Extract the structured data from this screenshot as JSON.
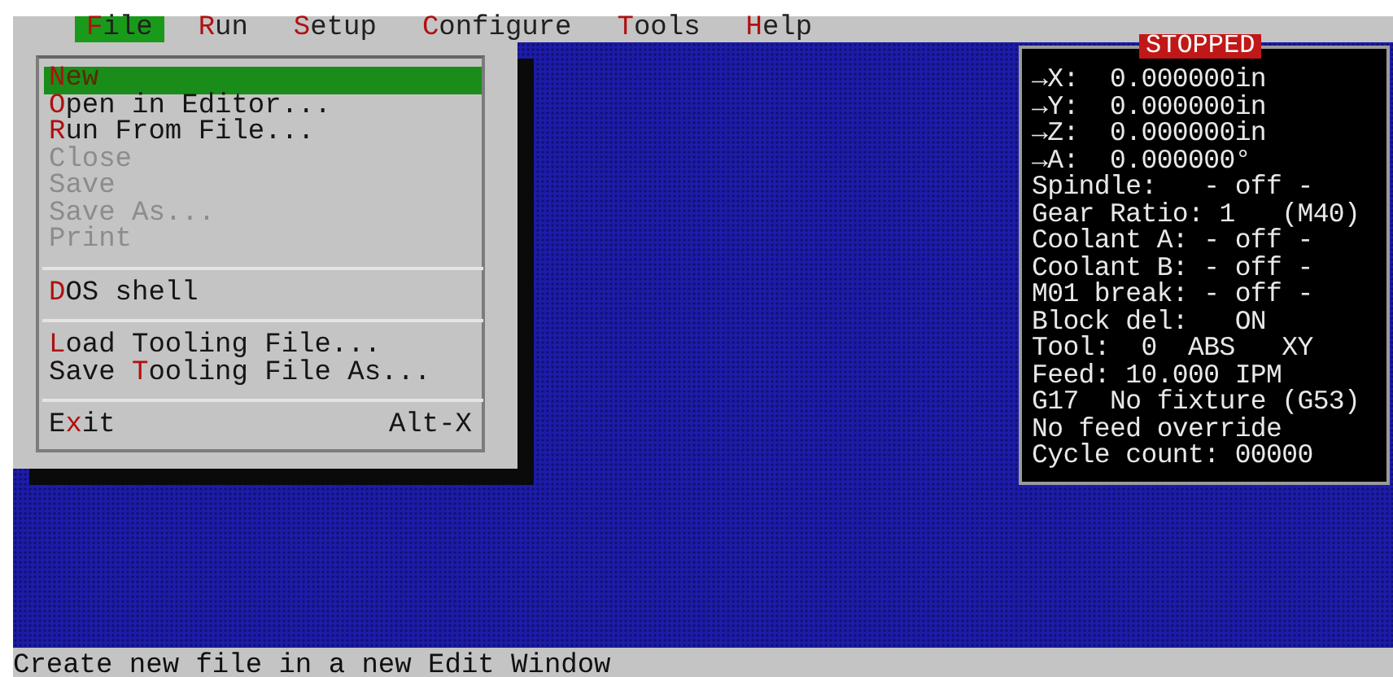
{
  "menu_bar": [
    {
      "key": "F",
      "rest": "ile",
      "selected": true
    },
    {
      "key": "R",
      "rest": "un",
      "selected": false
    },
    {
      "key": "S",
      "rest": "etup",
      "selected": false
    },
    {
      "key": "C",
      "rest": "onfigure",
      "selected": false
    },
    {
      "key": "T",
      "rest": "ools",
      "selected": false
    },
    {
      "key": "H",
      "rest": "elp",
      "selected": false
    }
  ],
  "file_menu": {
    "groups": [
      [
        {
          "key": "N",
          "rest": "ew",
          "selected": true,
          "disabled": false
        },
        {
          "key": "O",
          "rest": "pen in Editor...",
          "selected": false,
          "disabled": false
        },
        {
          "key": "R",
          "rest": "un From File...",
          "selected": false,
          "disabled": false
        },
        {
          "rest": "Close",
          "selected": false,
          "disabled": true
        },
        {
          "rest": "Save",
          "selected": false,
          "disabled": true
        },
        {
          "rest": "Save As...",
          "selected": false,
          "disabled": true
        },
        {
          "rest": "Print",
          "selected": false,
          "disabled": true
        }
      ],
      [
        {
          "key": "D",
          "rest": "OS shell",
          "selected": false,
          "disabled": false
        }
      ],
      [
        {
          "key": "L",
          "rest": "oad Tooling File...",
          "selected": false,
          "disabled": false
        },
        {
          "before": "Save ",
          "key": "T",
          "rest": "ooling File As...",
          "selected": false,
          "disabled": false
        }
      ],
      [
        {
          "before": "E",
          "key": "x",
          "rest": "it",
          "shortcut": "Alt-X",
          "selected": false,
          "disabled": false
        }
      ]
    ]
  },
  "status_panel": {
    "title": "STOPPED",
    "lines": [
      "→X:  0.000000in",
      "→Y:  0.000000in",
      "→Z:  0.000000in",
      "→A:  0.000000°",
      "Spindle:   - off -",
      "Gear Ratio: 1   (M40)",
      "Coolant A: - off -",
      "Coolant B: - off -",
      "M01 break: - off -",
      "Block del:   ON",
      "Tool:  0  ABS   XY",
      "Feed: 10.000 IPM",
      "G17  No fixture (G53)",
      "No feed override",
      "Cycle count: 00000"
    ]
  },
  "status_bar": "Create new file in a new Edit Window"
}
